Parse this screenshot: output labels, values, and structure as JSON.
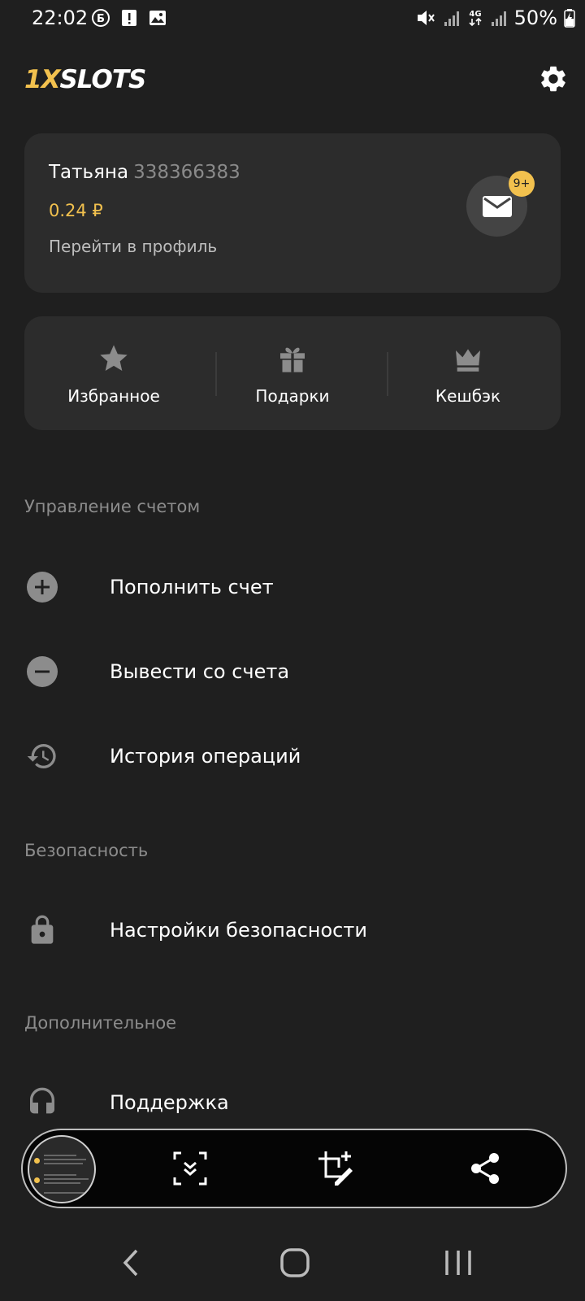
{
  "status_bar": {
    "time": "22:02",
    "left_icons": [
      "b-circle-icon",
      "alert-icon",
      "image-icon"
    ],
    "right_icons": [
      "mute-icon",
      "signal-icon",
      "4g-icon",
      "signal-icon"
    ],
    "battery": "50%"
  },
  "header": {
    "logo_part1": "1X",
    "logo_part2": "SLOTS",
    "settings_icon": "gear-icon"
  },
  "profile": {
    "name": "Татьяна",
    "id": "338366383",
    "balance": "0.24 ₽",
    "link": "Перейти в профиль",
    "messages_badge": "9+"
  },
  "quick_actions": [
    {
      "label": "Избранное",
      "icon": "star-icon"
    },
    {
      "label": "Подарки",
      "icon": "gift-icon"
    },
    {
      "label": "Кешбэк",
      "icon": "crown-icon"
    }
  ],
  "sections": {
    "account": {
      "title": "Управление счетом",
      "items": [
        {
          "label": "Пополнить счет",
          "icon": "plus-circle-icon"
        },
        {
          "label": "Вывести со счета",
          "icon": "minus-circle-icon"
        },
        {
          "label": "История операций",
          "icon": "history-icon"
        }
      ]
    },
    "security": {
      "title": "Безопасность",
      "items": [
        {
          "label": "Настройки безопасности",
          "icon": "lock-icon"
        }
      ]
    },
    "extra": {
      "title": "Дополнительное",
      "items": [
        {
          "label": "Поддержка",
          "icon": "headset-icon"
        }
      ]
    }
  },
  "screenshot_toolbar": {
    "actions": [
      "scroll-capture-icon",
      "crop-edit-icon",
      "share-icon"
    ]
  },
  "colors": {
    "background": "#1f1f1f",
    "card": "#2c2c2c",
    "accent": "#f2c14e",
    "muted": "#8c8c8c"
  }
}
